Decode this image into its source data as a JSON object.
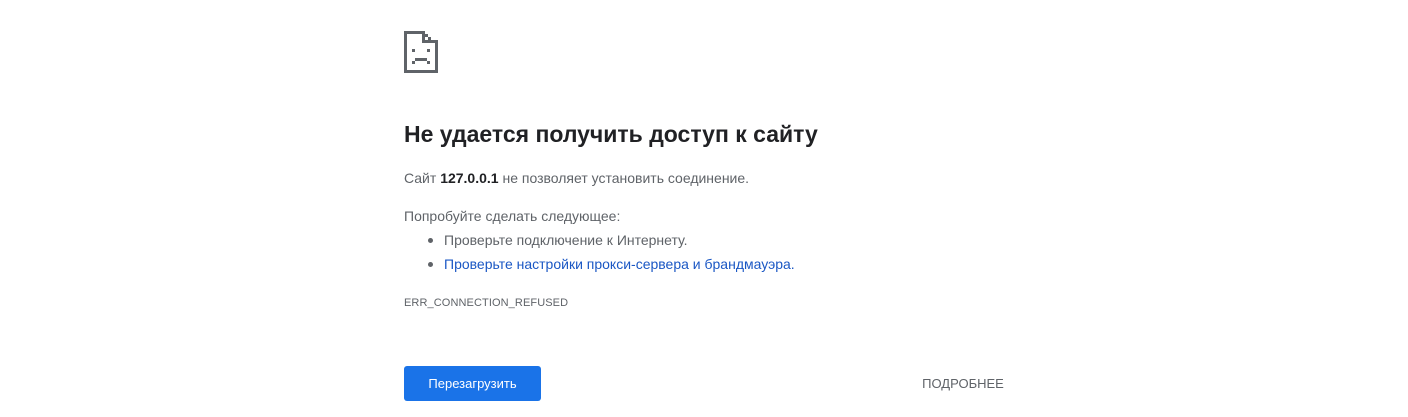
{
  "error_page": {
    "icon": "sad-document-icon",
    "title": "Не удается получить доступ к сайту",
    "summary": {
      "prefix": "Сайт ",
      "host": "127.0.0.1",
      "suffix": " не позволяет установить соединение."
    },
    "suggestions_heading": "Попробуйте сделать следующее:",
    "suggestions": [
      {
        "text": "Проверьте подключение к Интернету.",
        "is_link": false
      },
      {
        "text": "Проверьте настройки прокси-сервера и брандмауэра.",
        "is_link": true
      }
    ],
    "error_code": "ERR_CONNECTION_REFUSED",
    "reload_label": "Перезагрузить",
    "details_label": "ПОДРОБНЕЕ"
  },
  "colors": {
    "primary_button": "#1a73e8",
    "link": "#1a57c4",
    "text_secondary": "#5f6368",
    "text_primary": "#202124"
  }
}
